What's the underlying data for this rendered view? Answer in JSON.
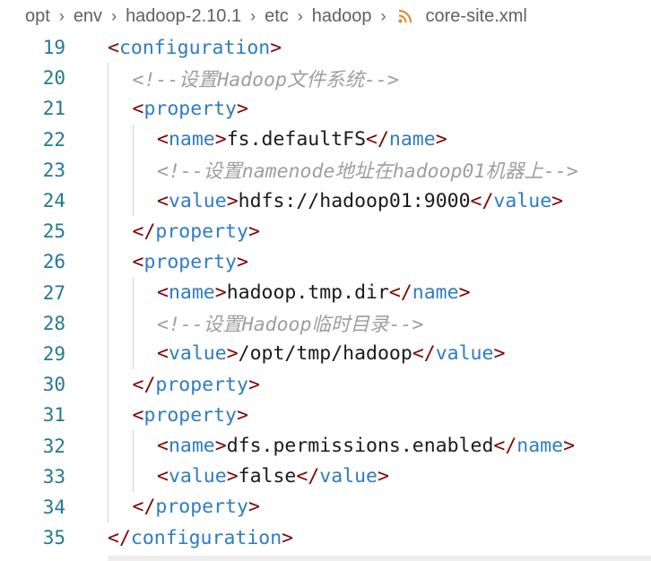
{
  "breadcrumb": {
    "items": [
      "opt",
      "env",
      "hadoop-2.10.1",
      "etc",
      "hadoop"
    ],
    "file": "core-site.xml",
    "separator": "›",
    "file_icon": "rss-icon",
    "file_icon_color": "#e8802a"
  },
  "colors": {
    "line_number": "#237893",
    "tag_bracket": "#800000",
    "tag_name": "#2f7cc2",
    "text": "#1a1a1a",
    "comment": "#9e9e9e"
  },
  "editor": {
    "lines": [
      {
        "num": "19",
        "depth": 0,
        "tokens": [
          [
            "<",
            "tag"
          ],
          [
            "configuration",
            "name"
          ],
          [
            ">",
            "tag"
          ]
        ]
      },
      {
        "num": "20",
        "depth": 1,
        "tokens": [
          [
            "<!--设置Hadoop文件系统-->",
            "comment"
          ]
        ]
      },
      {
        "num": "21",
        "depth": 1,
        "tokens": [
          [
            "<",
            "tag"
          ],
          [
            "property",
            "name"
          ],
          [
            ">",
            "tag"
          ]
        ]
      },
      {
        "num": "22",
        "depth": 2,
        "tokens": [
          [
            "<",
            "tag"
          ],
          [
            "name",
            "name"
          ],
          [
            ">",
            "tag"
          ],
          [
            "fs.defaultFS",
            "text"
          ],
          [
            "</",
            "tag"
          ],
          [
            "name",
            "name"
          ],
          [
            ">",
            "tag"
          ]
        ]
      },
      {
        "num": "23",
        "depth": 2,
        "tokens": [
          [
            "<!--设置namenode地址在hadoop01机器上-->",
            "comment"
          ]
        ]
      },
      {
        "num": "24",
        "depth": 2,
        "tokens": [
          [
            "<",
            "tag"
          ],
          [
            "value",
            "name"
          ],
          [
            ">",
            "tag"
          ],
          [
            "hdfs://hadoop01:9000",
            "text"
          ],
          [
            "</",
            "tag"
          ],
          [
            "value",
            "name"
          ],
          [
            ">",
            "tag"
          ]
        ]
      },
      {
        "num": "25",
        "depth": 1,
        "tokens": [
          [
            "</",
            "tag"
          ],
          [
            "property",
            "name"
          ],
          [
            ">",
            "tag"
          ]
        ]
      },
      {
        "num": "26",
        "depth": 1,
        "tokens": [
          [
            "<",
            "tag"
          ],
          [
            "property",
            "name"
          ],
          [
            ">",
            "tag"
          ]
        ]
      },
      {
        "num": "27",
        "depth": 2,
        "tokens": [
          [
            "<",
            "tag"
          ],
          [
            "name",
            "name"
          ],
          [
            ">",
            "tag"
          ],
          [
            "hadoop.tmp.dir",
            "text"
          ],
          [
            "</",
            "tag"
          ],
          [
            "name",
            "name"
          ],
          [
            ">",
            "tag"
          ]
        ]
      },
      {
        "num": "28",
        "depth": 2,
        "tokens": [
          [
            "<!--设置Hadoop临时目录-->",
            "comment"
          ]
        ]
      },
      {
        "num": "29",
        "depth": 2,
        "tokens": [
          [
            "<",
            "tag"
          ],
          [
            "value",
            "name"
          ],
          [
            ">",
            "tag"
          ],
          [
            "/opt/tmp/hadoop",
            "text"
          ],
          [
            "</",
            "tag"
          ],
          [
            "value",
            "name"
          ],
          [
            ">",
            "tag"
          ]
        ]
      },
      {
        "num": "30",
        "depth": 1,
        "tokens": [
          [
            "</",
            "tag"
          ],
          [
            "property",
            "name"
          ],
          [
            ">",
            "tag"
          ]
        ]
      },
      {
        "num": "31",
        "depth": 1,
        "tokens": [
          [
            "<",
            "tag"
          ],
          [
            "property",
            "name"
          ],
          [
            ">",
            "tag"
          ]
        ]
      },
      {
        "num": "32",
        "depth": 2,
        "tokens": [
          [
            "<",
            "tag"
          ],
          [
            "name",
            "name"
          ],
          [
            ">",
            "tag"
          ],
          [
            "dfs.permissions.enabled",
            "text"
          ],
          [
            "</",
            "tag"
          ],
          [
            "name",
            "name"
          ],
          [
            ">",
            "tag"
          ]
        ]
      },
      {
        "num": "33",
        "depth": 2,
        "tokens": [
          [
            "<",
            "tag"
          ],
          [
            "value",
            "name"
          ],
          [
            ">",
            "tag"
          ],
          [
            "false",
            "text"
          ],
          [
            "</",
            "tag"
          ],
          [
            "value",
            "name"
          ],
          [
            ">",
            "tag"
          ]
        ]
      },
      {
        "num": "34",
        "depth": 1,
        "tokens": [
          [
            "</",
            "tag"
          ],
          [
            "property",
            "name"
          ],
          [
            ">",
            "tag"
          ]
        ]
      },
      {
        "num": "35",
        "depth": 0,
        "tokens": [
          [
            "</",
            "tag"
          ],
          [
            "configuration",
            "name"
          ],
          [
            ">",
            "tag"
          ]
        ]
      }
    ]
  }
}
